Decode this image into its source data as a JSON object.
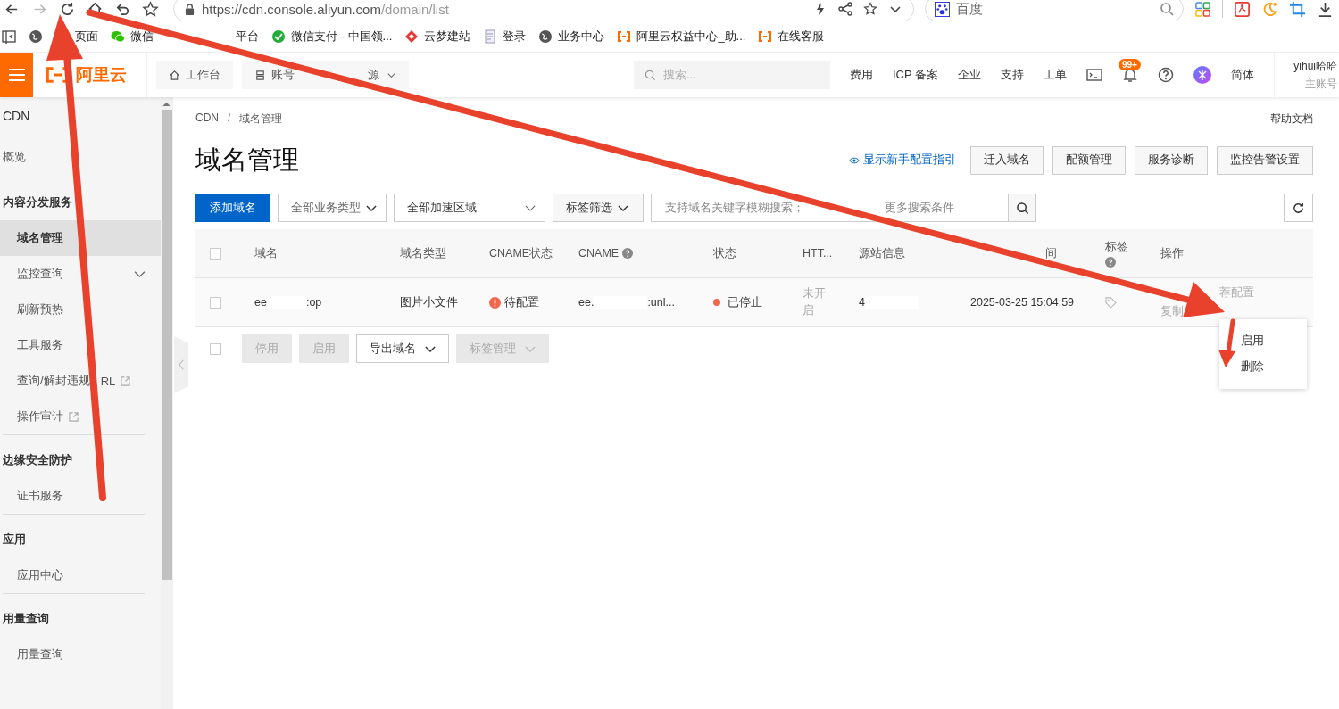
{
  "browser": {
    "url_host": "https://cdn.console.aliyun.com",
    "url_path": "/domain/list",
    "search_engine": "百度"
  },
  "bookmarks": [
    {
      "label": "页面",
      "kind": "globe"
    },
    {
      "label": "微信",
      "label_end": "平台",
      "kind": "wechat"
    },
    {
      "label": "微信支付 - 中国领...",
      "kind": "pay"
    },
    {
      "label": "云梦建站",
      "kind": "diamond"
    },
    {
      "label": "登录",
      "kind": "doc"
    },
    {
      "label": "业务中心",
      "kind": "globe"
    },
    {
      "label": "阿里云权益中心_助...",
      "kind": "aliyun"
    },
    {
      "label": "在线客服",
      "kind": "aliyun"
    }
  ],
  "header": {
    "logo": "阿里云",
    "workbench": "工作台",
    "resources": "账号",
    "resources_end": "源",
    "search_placeholder": "搜索...",
    "links": [
      "费用",
      "ICP 备案",
      "企业",
      "支持",
      "工单"
    ],
    "badge": "99+",
    "language": "简体",
    "user_name": "yihui哈哈",
    "user_role": "主账号"
  },
  "sidebar": {
    "title": "CDN",
    "sections": [
      {
        "items": [
          {
            "label": "概览",
            "kind": "top",
            "selected": false
          }
        ]
      },
      {
        "title": "内容分发服务",
        "items": [
          {
            "label": "域名管理",
            "kind": "item",
            "selected": true
          },
          {
            "label": "监控查询",
            "kind": "expand",
            "selected": false
          },
          {
            "label": "刷新预热",
            "kind": "item",
            "selected": false
          },
          {
            "label": "工具服务",
            "kind": "item",
            "selected": false
          },
          {
            "label": "查询/解封违规",
            "label_end": "RL",
            "kind": "external",
            "selected": false
          },
          {
            "label": "操作审计",
            "kind": "external",
            "selected": false
          }
        ]
      },
      {
        "title": "边缘安全防护",
        "items": [
          {
            "label": "证书服务",
            "kind": "item",
            "selected": false
          }
        ]
      },
      {
        "title": "应用",
        "items": [
          {
            "label": "应用中心",
            "kind": "item",
            "selected": false
          }
        ]
      },
      {
        "title": "用量查询",
        "items": [
          {
            "label": "用量查询",
            "kind": "item",
            "selected": false
          }
        ]
      }
    ]
  },
  "breadcrumb": [
    "CDN",
    "域名管理"
  ],
  "breadcrumb_separator": "/",
  "help_link": "帮助文档",
  "page_title": "域名管理",
  "guide_link": "显示新手配置指引",
  "top_buttons": [
    "迁入域名",
    "配额管理",
    "服务诊断",
    "监控告警设置"
  ],
  "toolbar": {
    "add_button": "添加域名",
    "business_type": "全部业务类型",
    "region": "全部加速区域",
    "tag_filter": "标签筛选",
    "search_placeholder": "支持域名关键字模糊搜索；",
    "search_placeholder_end": "更多搜索条件"
  },
  "table": {
    "select_all": {
      "checked": false
    },
    "columns": [
      {
        "label": "域名",
        "help": false
      },
      {
        "label": "域名类型",
        "help": false
      },
      {
        "label": "CNAME状态",
        "help": false
      },
      {
        "label": "CNAME",
        "help": true
      },
      {
        "label": "状态",
        "help": false
      },
      {
        "label": "HTT...",
        "help": false
      },
      {
        "label": "源站信息",
        "help": false
      },
      {
        "label": "间",
        "help": false
      },
      {
        "label": "标签",
        "help": true
      },
      {
        "label": "操作",
        "help": false
      }
    ],
    "rows": [
      {
        "checked": false,
        "domain_start": "ee",
        "domain_end": ":op",
        "type": "图片小文件",
        "cname_status": "待配置",
        "cname_start": "ee.",
        "cname_end": ":unl...",
        "status": "已停止",
        "color": "#f0674c",
        "https": "未开启",
        "origin": "4",
        "created": "2025-03-25 15:04:59",
        "actions": [
          "荐配置",
          "复制"
        ]
      }
    ],
    "footer_select": {
      "checked": false
    }
  },
  "footer_buttons": [
    {
      "label": "停用",
      "disabled": true
    },
    {
      "label": "启用",
      "disabled": true
    },
    {
      "label": "导出域名",
      "disabled": false
    },
    {
      "label": "标签管理",
      "disabled": true
    }
  ],
  "more_menu": [
    "启用",
    "删除"
  ]
}
